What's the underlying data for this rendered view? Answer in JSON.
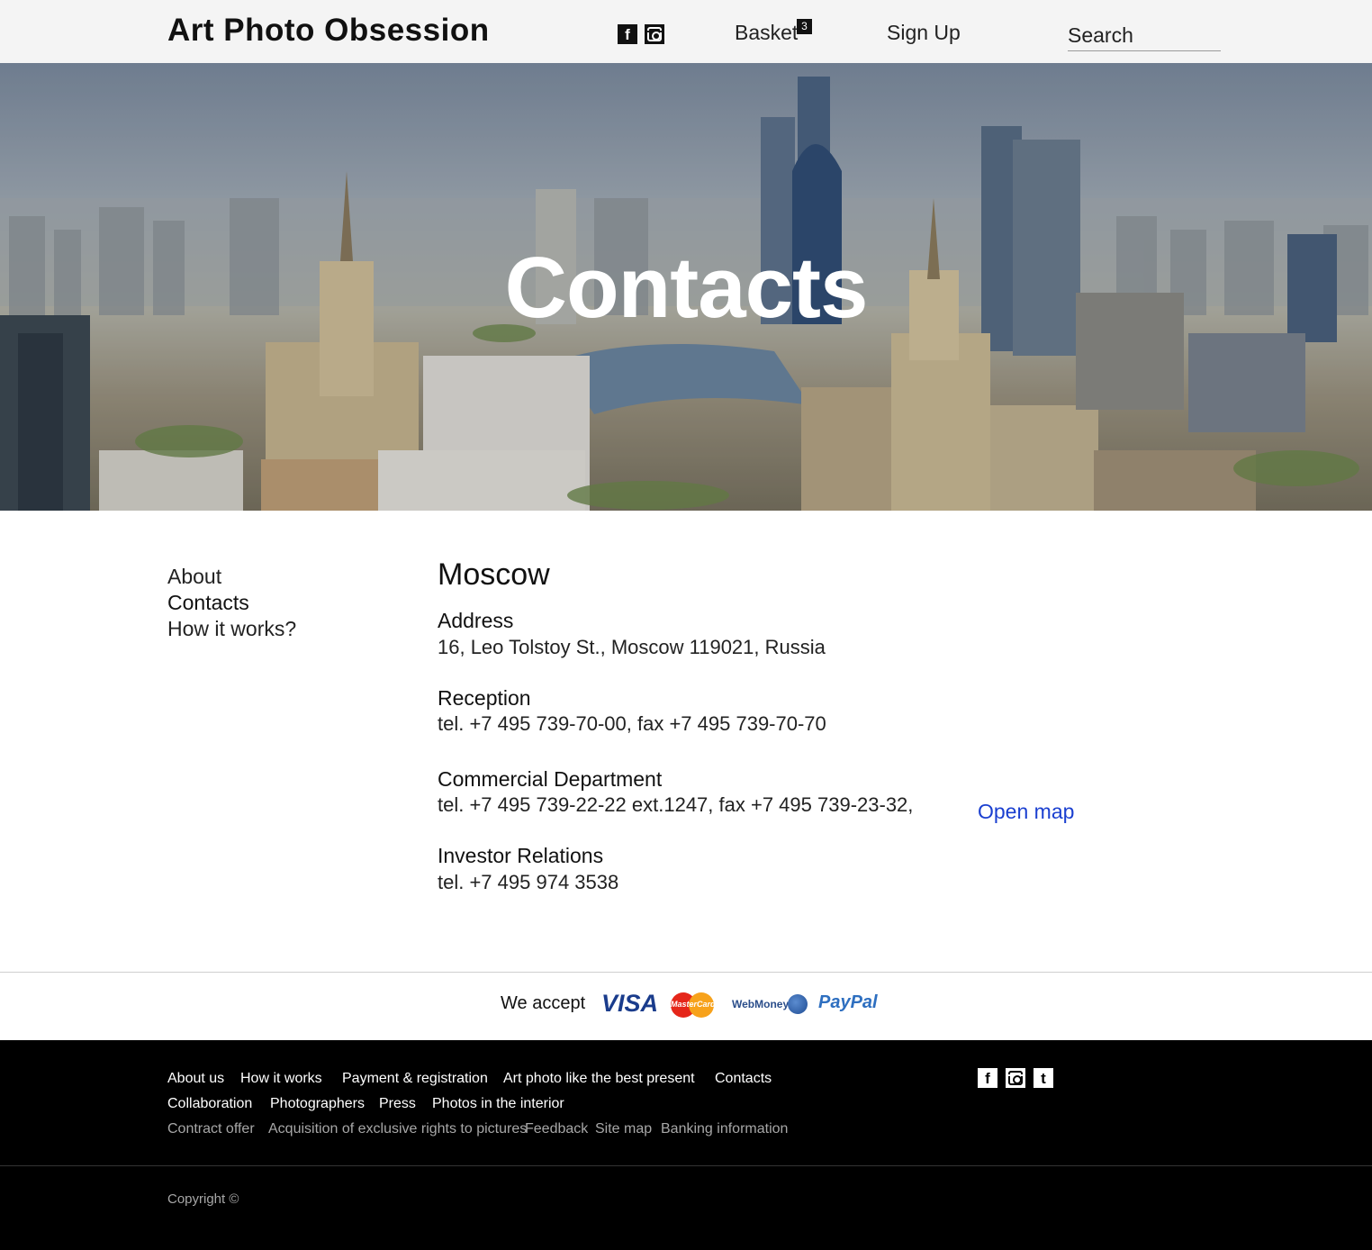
{
  "header": {
    "logo": "Art Photo Obsession",
    "basket_label": "Basket",
    "basket_count": "3",
    "signup_label": "Sign Up",
    "search_placeholder": "Search",
    "social": [
      "facebook-icon",
      "instagram-icon"
    ]
  },
  "hero": {
    "title": "Contacts"
  },
  "sidebar": {
    "items": [
      {
        "label": "About",
        "active": false
      },
      {
        "label": "Contacts",
        "active": true
      },
      {
        "label": "How it works?",
        "active": false
      }
    ]
  },
  "contact": {
    "city": "Moscow",
    "sections": [
      {
        "title": "Address",
        "text": "16, Leo Tolstoy St., Moscow 119021, Russia"
      },
      {
        "title": "Reception",
        "text": "tel. +7 495 739-70-00, fax +7 495 739-70-70"
      },
      {
        "title": "Commercial Department",
        "text": "tel. +7 495 739-22-22 ext.1247, fax +7 495 739-23-32,"
      },
      {
        "title": "Investor Relations",
        "text": "tel. +7 495 974 3538"
      }
    ],
    "open_map": "Open map"
  },
  "payments": {
    "label": "We accept",
    "methods": [
      "VISA",
      "MasterCard",
      "WebMoney",
      "PayPal"
    ]
  },
  "footer": {
    "row1": [
      "About us",
      "How it works",
      "Payment & registration",
      "Art photo like the best present",
      "Contacts"
    ],
    "row2": [
      "Collaboration",
      "Photographers",
      "Press",
      "Photos in the interior"
    ],
    "row3": [
      "Contract offer",
      "Acquisition of exclusive rights to pictures",
      "Feedback",
      "Site map",
      "Banking information"
    ],
    "social": [
      "facebook-icon",
      "instagram-icon",
      "tumblr-icon"
    ],
    "copyright": "Copyright ©"
  },
  "colors": {
    "header_bg": "#f4f4f4",
    "link_blue": "#1a3fd0",
    "footer_bg": "#000000",
    "footer_muted": "#a7a7a7"
  }
}
